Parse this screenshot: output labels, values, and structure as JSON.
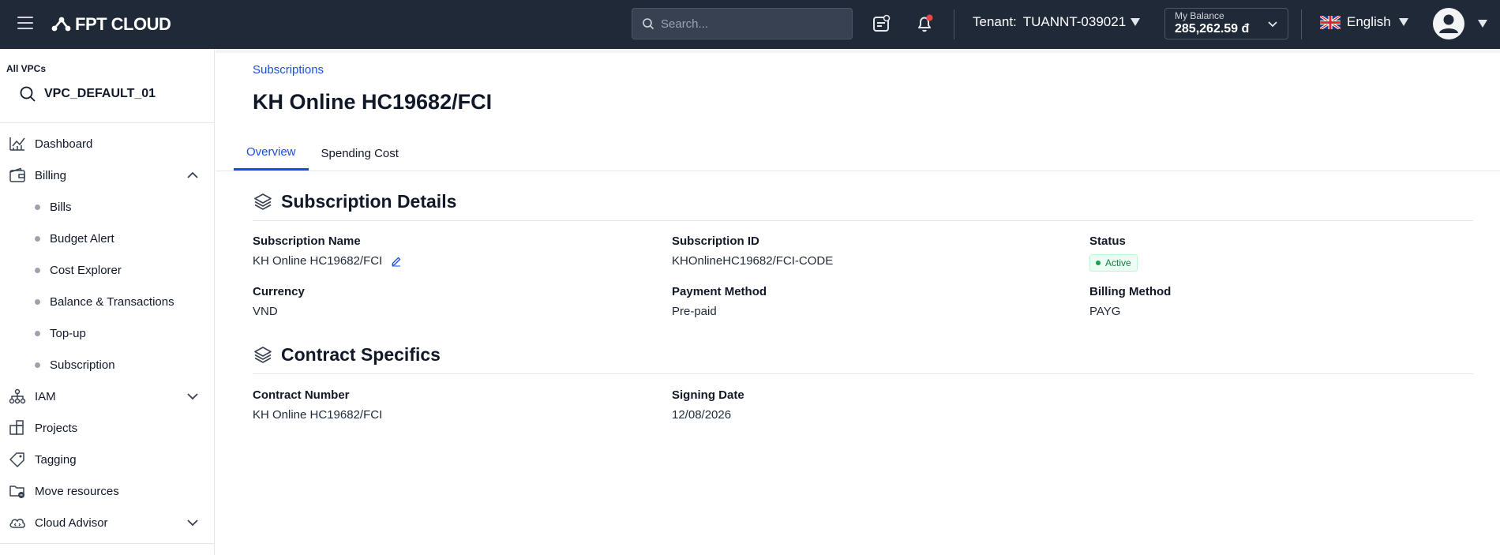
{
  "app": {
    "brand": "FPT CLOUD",
    "search_placeholder": "Search...",
    "tenant_label": "Tenant:",
    "tenant_value": "TUANNT-039021",
    "balance_label": "My Balance",
    "balance_value": "285,262.59 đ",
    "language": "English",
    "colors": {
      "topbar": "#1f2937",
      "accent": "#1d4ed8",
      "status_active": "#16a34a"
    }
  },
  "sidebar": {
    "vpc_label": "All VPCs",
    "vpc_value": "VPC_DEFAULT_01",
    "items": [
      {
        "label": "Dashboard",
        "icon": "chart-icon"
      },
      {
        "label": "Billing",
        "icon": "wallet-icon",
        "expanded": true
      },
      {
        "label": "IAM",
        "icon": "hierarchy-icon"
      },
      {
        "label": "Projects",
        "icon": "projects-icon"
      },
      {
        "label": "Tagging",
        "icon": "tag-icon"
      },
      {
        "label": "Move resources",
        "icon": "move-icon"
      },
      {
        "label": "Cloud Advisor",
        "icon": "cloud-icon"
      }
    ],
    "billing_sub": [
      "Bills",
      "Budget Alert",
      "Cost Explorer",
      "Balance & Transactions",
      "Top-up",
      "Subscription"
    ]
  },
  "main": {
    "breadcrumb": "Subscriptions",
    "title": "KH Online HC19682/FCI",
    "tabs": [
      "Overview",
      "Spending Cost"
    ],
    "active_tab": "Overview",
    "details": {
      "heading": "Subscription Details",
      "fields": [
        {
          "label": "Subscription Name",
          "value": "KH Online HC19682/FCI"
        },
        {
          "label": "Subscription ID",
          "value": "KHOnlineHC19682/FCI-CODE"
        },
        {
          "label": "Status",
          "value": "Active"
        },
        {
          "label": "Currency",
          "value": "VND"
        },
        {
          "label": "Payment Method",
          "value": "Pre-paid"
        },
        {
          "label": "Billing Method",
          "value": "PAYG"
        }
      ]
    },
    "contract": {
      "heading": "Contract Specifics",
      "fields": [
        {
          "label": "Contract Number",
          "value": "KH Online HC19682/FCI"
        },
        {
          "label": "Signing Date",
          "value": "12/08/2026"
        }
      ]
    }
  }
}
